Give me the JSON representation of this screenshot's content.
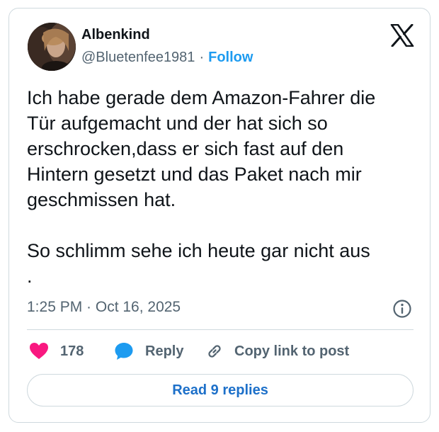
{
  "user": {
    "display_name": "Albenkind",
    "handle": "@Bluetenfee1981",
    "separator": "·",
    "follow_label": "Follow"
  },
  "tweet": {
    "text": "Ich habe gerade dem Amazon-Fahrer die\nTür aufgemacht und der hat sich so\nerschrocken,dass er sich fast auf den\nHintern gesetzt und das Paket nach mir\ngeschmissen hat.\n\nSo schlimm sehe ich heute gar nicht aus\n.",
    "timestamp": "1:25 PM · Oct 16, 2025"
  },
  "actions": {
    "like_count": "178",
    "reply_label": "Reply",
    "copy_link_label": "Copy link to post"
  },
  "footer": {
    "read_replies_label": "Read 9 replies"
  },
  "icons": {
    "brand_logo": "x-logo-icon",
    "info": "info-icon",
    "like": "heart-icon",
    "reply": "speech-bubble-icon",
    "copy_link": "link-icon"
  },
  "colors": {
    "accent": "#1d9bf0",
    "like": "#f91880",
    "text": "#0f1419",
    "muted": "#536471",
    "border": "#cfd9de"
  }
}
